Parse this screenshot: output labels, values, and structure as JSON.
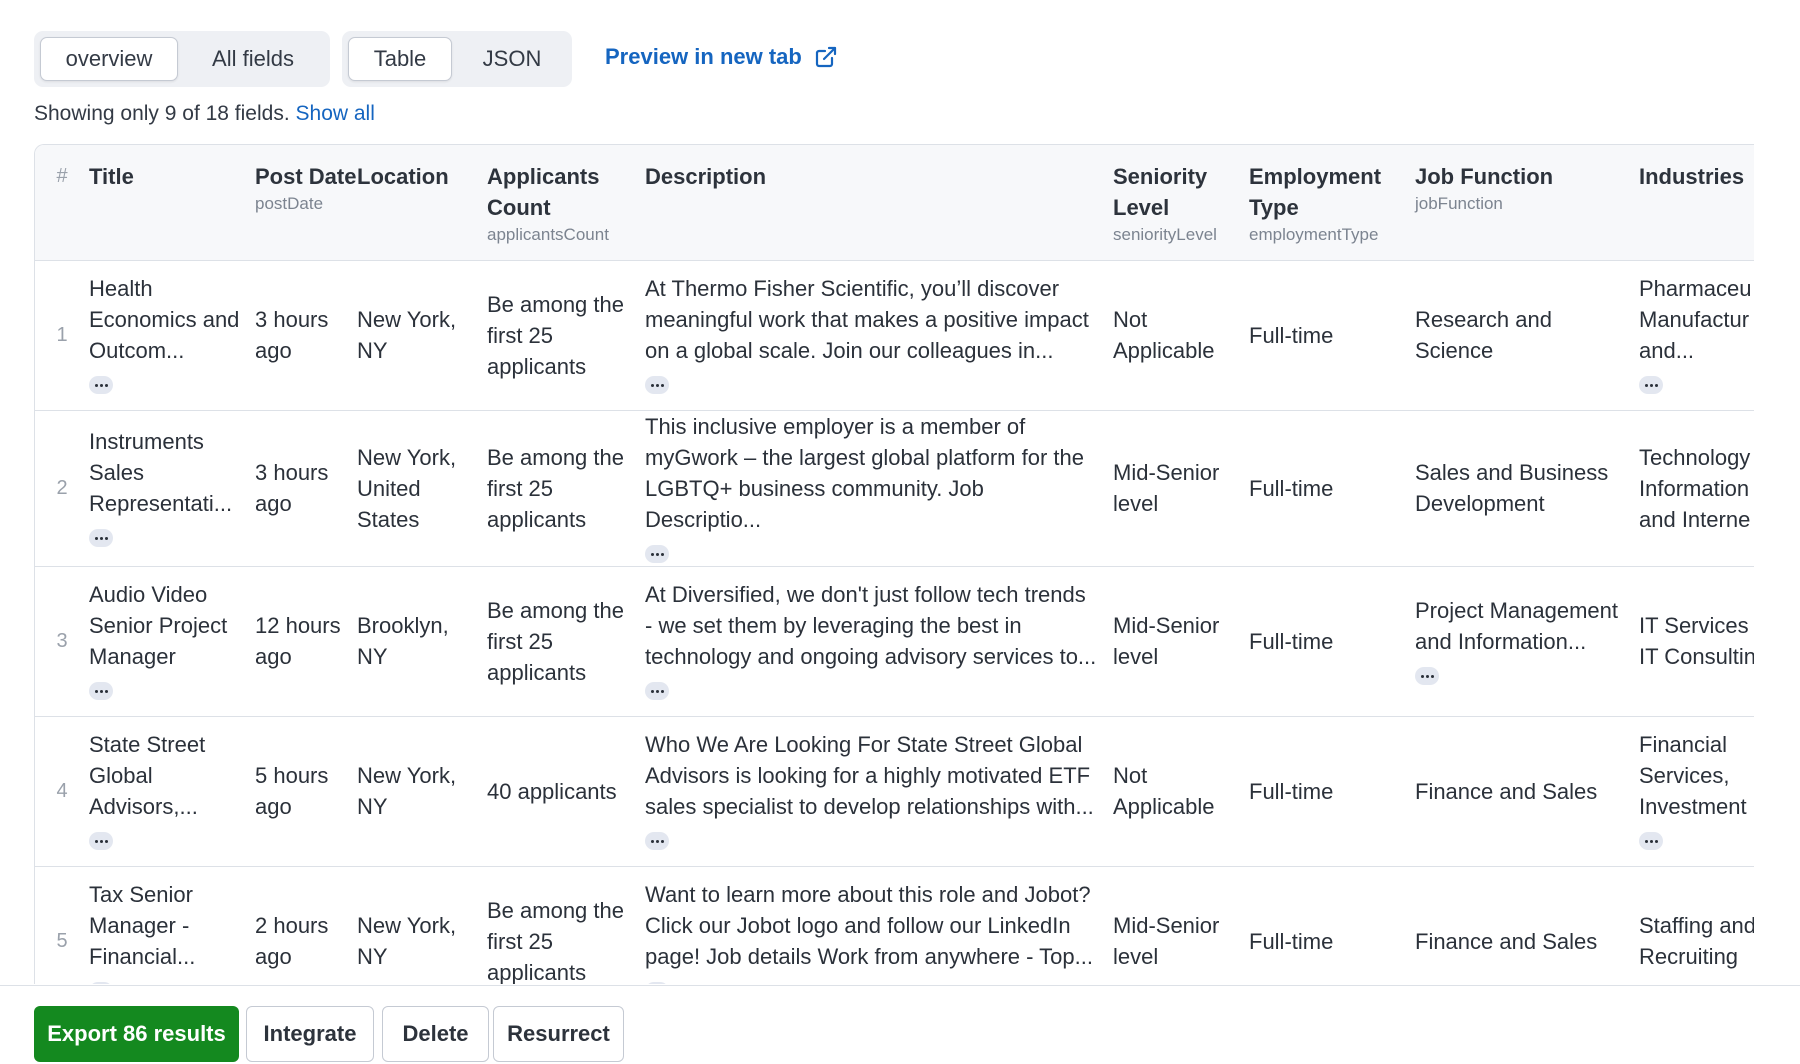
{
  "view_tabs": {
    "overview": "overview",
    "all_fields": "All fields"
  },
  "format_tabs": {
    "table": "Table",
    "json": "JSON"
  },
  "preview_label": "Preview in new tab",
  "showing": {
    "text": "Showing only 9 of 18 fields.",
    "link": "Show all"
  },
  "columns": [
    {
      "label": "#",
      "sub": ""
    },
    {
      "label": "Title",
      "sub": ""
    },
    {
      "label": "Post Date",
      "sub": "postDate"
    },
    {
      "label": "Location",
      "sub": ""
    },
    {
      "label": "Applicants Count",
      "sub": "applicantsCount"
    },
    {
      "label": "Description",
      "sub": ""
    },
    {
      "label": "Seniority Level",
      "sub": "seniorityLevel"
    },
    {
      "label": "Employment Type",
      "sub": "employmentType"
    },
    {
      "label": "Job Function",
      "sub": "jobFunction"
    },
    {
      "label": "Industries",
      "sub": ""
    }
  ],
  "rows": [
    {
      "num": "1",
      "title": "Health Economics and Outcom...",
      "post_date": "3 hours ago",
      "location": "New York, NY",
      "applicants": "Be among the first 25 applicants",
      "description": "At Thermo Fisher Scientific, you’ll discover meaningful work that makes a positive impact on a global scale. Join our colleagues in...",
      "seniority": "Not Applicable",
      "employment": "Full-time",
      "job_function": "Research and Science",
      "industries": "Pharmaceu​Manufactur and..."
    },
    {
      "num": "2",
      "title": "Instruments Sales Representati...",
      "post_date": "3 hours ago",
      "location": "New York, United States",
      "applicants": "Be among the first 25 applicants",
      "description": "This inclusive employer is a member of myGwork – the largest global platform for the LGBTQ+ business community. Job Descriptio...",
      "seniority": "Mid-Senior level",
      "employment": "Full-time",
      "job_function": "Sales and Business Development",
      "industries": "Technology Information and Interne"
    },
    {
      "num": "3",
      "title": "Audio Video Senior Project Manager",
      "post_date": "12 hours ago",
      "location": "Brooklyn, NY",
      "applicants": "Be among the first 25 applicants",
      "description": "At Diversified, we don't just follow tech trends - we set them by leveraging the best in technology and ongoing advisory services to...",
      "seniority": "Mid-Senior level",
      "employment": "Full-time",
      "job_function": "Project Management and Information...",
      "industries": "IT Services a IT Consultin"
    },
    {
      "num": "4",
      "title": "State Street Global Advisors,...",
      "post_date": "5 hours ago",
      "location": "New York, NY",
      "applicants": "40 applicants",
      "description": "Who We Are Looking For State Street Global Advisors is looking for a highly motivated ETF sales specialist to develop relationships with...",
      "seniority": "Not Applicable",
      "employment": "Full-time",
      "job_function": "Finance and Sales",
      "industries": "Financial Services, Investment"
    },
    {
      "num": "5",
      "title": "Tax Senior Manager - Financial...",
      "post_date": "2 hours ago",
      "location": "New York, NY",
      "applicants": "Be among the first 25 applicants",
      "description": "Want to learn more about this role and Jobot? Click our Jobot logo and follow our LinkedIn page! Job details Work from anywhere - Top...",
      "seniority": "Mid-Senior level",
      "employment": "Full-time",
      "job_function": "Finance and Sales",
      "industries": "Staffing and Recruiting"
    }
  ],
  "footer": {
    "export": "Export 86 results",
    "integrate": "Integrate",
    "delete": "Delete",
    "resurrect": "Resurrect"
  },
  "colors": {
    "link": "#1565c0",
    "export_bg": "#14891f"
  }
}
